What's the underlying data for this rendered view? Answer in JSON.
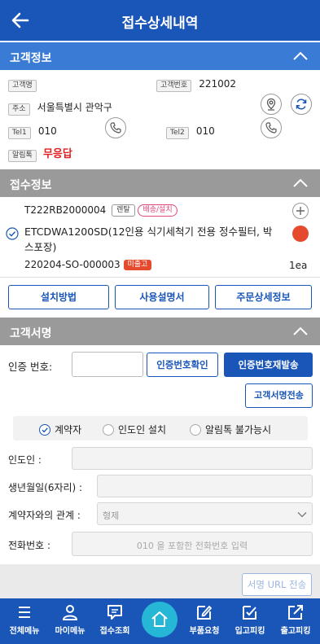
{
  "header": {
    "title": "접수상세내역"
  },
  "customer_section": {
    "title": "고객정보",
    "name_tag": "고객명",
    "name_value": "",
    "number_tag": "고객번호",
    "number_value": "221002",
    "address_tag": "주소",
    "address_value": "서울특별시 관악구",
    "tel1_tag": "Tel1",
    "tel1_value": "010",
    "tel2_tag": "Tel2",
    "tel2_value": "010",
    "alimtalk_tag": "알림톡",
    "alimtalk_value": "무응답"
  },
  "order_section": {
    "title": "접수정보",
    "order_code": "T222RB2000004",
    "badge_rental": "렌탈",
    "badge_delivery": "배송/설치",
    "product_text": "ETCDWA1200SD(12인용 식기세척기 전용 정수필터, 박스포장)",
    "order_number": "220204-SO-000003",
    "badge_status": "미출고",
    "quantity": "1ea",
    "buttons": {
      "install_method": "설치방법",
      "user_manual": "사용설명서",
      "order_detail": "주문상세정보"
    }
  },
  "signature_section": {
    "title": "고객서명",
    "auth_label": "인증 번호:",
    "auth_value": "",
    "confirm_button": "인증번호확인",
    "resend_button": "인증번호재발송",
    "sign_send_button": "고객서명전송",
    "radios": [
      {
        "label": "계약자",
        "checked": true
      },
      {
        "label": "인도인 설치",
        "checked": false
      },
      {
        "label": "알림톡 불가능시",
        "checked": false
      }
    ],
    "receiver_label": "인도인 :",
    "birth_label": "생년월일(6자리) :",
    "relation_label": "계약자와의 관계 :",
    "relation_selected": "형제",
    "phone_label": "전화번호 :",
    "phone_placeholder": "010 을 포함한 전화번호 입력",
    "url_send_button": "서명 URL 전송"
  },
  "bottom_nav": {
    "items": [
      {
        "label": "전체메뉴",
        "icon": "menu-icon"
      },
      {
        "label": "마이메뉴",
        "icon": "person-icon"
      },
      {
        "label": "접수조회",
        "icon": "chat-icon"
      },
      {
        "label": "",
        "icon": "home-icon"
      },
      {
        "label": "부품요청",
        "icon": "edit-icon"
      },
      {
        "label": "입고피킹",
        "icon": "edit-check-icon"
      },
      {
        "label": "출고피킹",
        "icon": "external-icon"
      }
    ]
  },
  "colors": {
    "primary": "#1a56b8",
    "section_blue": "#3a7bd5",
    "section_gray": "#9a9a9a",
    "alert_red": "#e02020",
    "home_teal": "#27b7d6",
    "status_dot": "#e64a2e"
  }
}
